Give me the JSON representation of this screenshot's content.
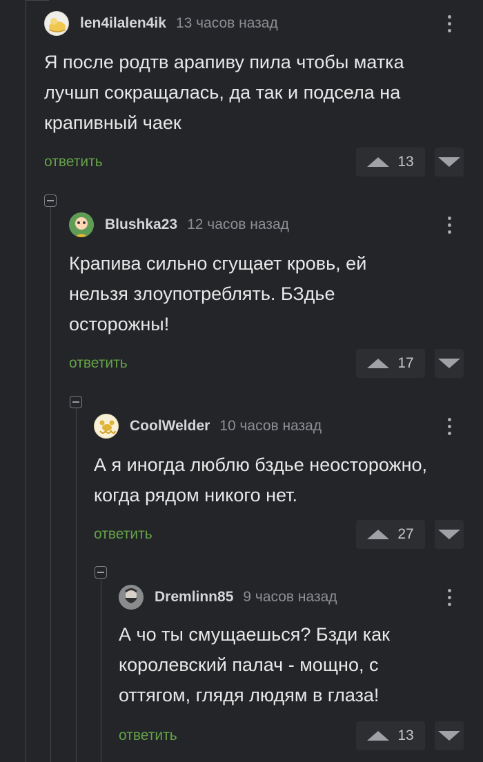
{
  "comments": [
    {
      "username": "len4ilalen4ik",
      "time": "13 часов назад",
      "lines": [
        "Я после родтв арапиву пила чтобы матка",
        "лучшп сокращалась, да так и подсела на",
        "крапивный чаек"
      ],
      "reply": "ответить",
      "score": "13",
      "avatar": "yellow-drawing-avatar"
    },
    {
      "username": "Blushka23",
      "time": "12 часов назад",
      "lines": [
        "Крапива сильно сгущает кровь, ей",
        "нельзя злоупотреблять. БЗдье",
        "осторожны!"
      ],
      "reply": "ответить",
      "score": "17",
      "avatar": "cartoon-character-avatar"
    },
    {
      "username": "CoolWelder",
      "time": "10 часов назад",
      "lines": [
        "А я иногда люблю бздье неосторожно,",
        "когда рядом никого нет."
      ],
      "reply": "ответить",
      "score": "27",
      "avatar": "flying-spaghetti-avatar"
    },
    {
      "username": "Dremlinn85",
      "time": "9 часов назад",
      "lines": [
        "А чо ты смущаешься? Бзди как",
        "королевский палач - мощно, с",
        "оттягом, глядя людям в глаза!"
      ],
      "reply": "ответить",
      "score": "13",
      "avatar": "bearded-man-avatar"
    }
  ],
  "colors": {
    "background": "#242529",
    "reply_link": "#64a248",
    "vote_box": "#2d2e32",
    "thread_line": "#45474d"
  },
  "icons": {
    "upvote": "triangle-up-icon",
    "downvote": "triangle-down-icon",
    "menu": "more-vertical-icon",
    "collapse": "collapse-minus-icon"
  }
}
